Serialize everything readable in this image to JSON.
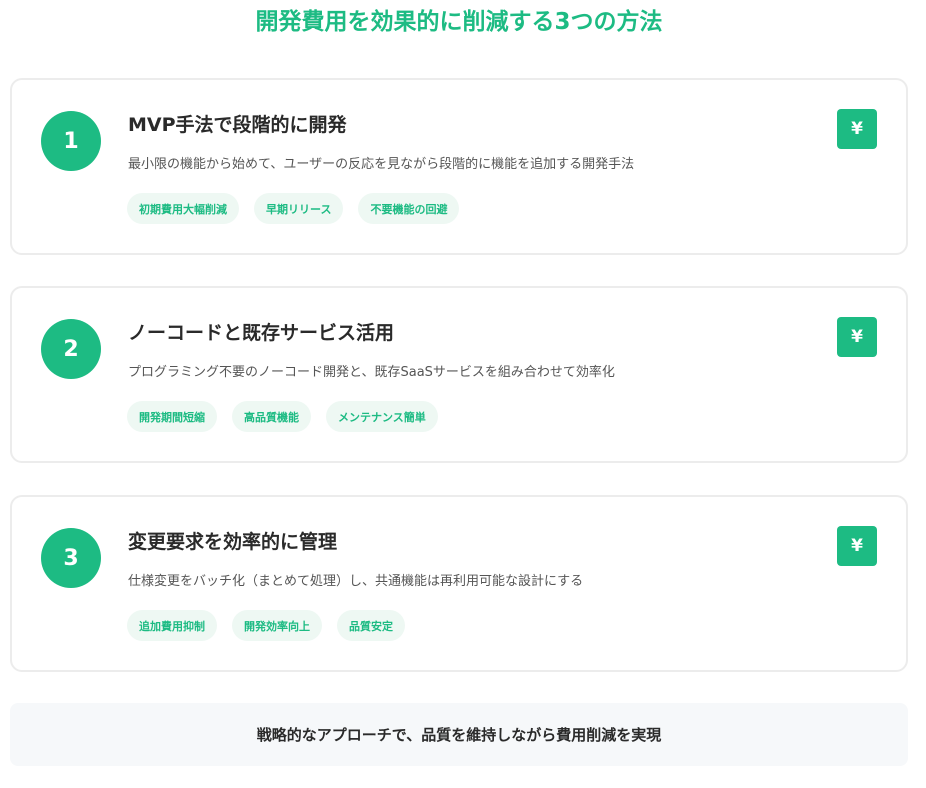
{
  "title": "開発費用を効果的に削減する3つの方法",
  "accent_color": "#1dbb83",
  "methods": [
    {
      "number": "1",
      "title": "MVP手法で段階的に開発",
      "description": "最小限の機能から始めて、ユーザーの反応を見ながら段階的に機能を追加する開発手法",
      "icon": "yen-icon",
      "icon_glyph": "¥",
      "tags": [
        "初期費用大幅削減",
        "早期リリース",
        "不要機能の回避"
      ]
    },
    {
      "number": "2",
      "title": "ノーコードと既存サービス活用",
      "description": "プログラミング不要のノーコード開発と、既存SaaSサービスを組み合わせて効率化",
      "icon": "yen-icon",
      "icon_glyph": "¥",
      "tags": [
        "開発期間短縮",
        "高品質機能",
        "メンテナンス簡単"
      ]
    },
    {
      "number": "3",
      "title": "変更要求を効率的に管理",
      "description": "仕様変更をバッチ化（まとめて処理）し、共通機能は再利用可能な設計にする",
      "icon": "yen-icon",
      "icon_glyph": "¥",
      "tags": [
        "追加費用抑制",
        "開発効率向上",
        "品質安定"
      ]
    }
  ],
  "footer": "戦略的なアプローチで、品質を維持しながら費用削減を実現"
}
